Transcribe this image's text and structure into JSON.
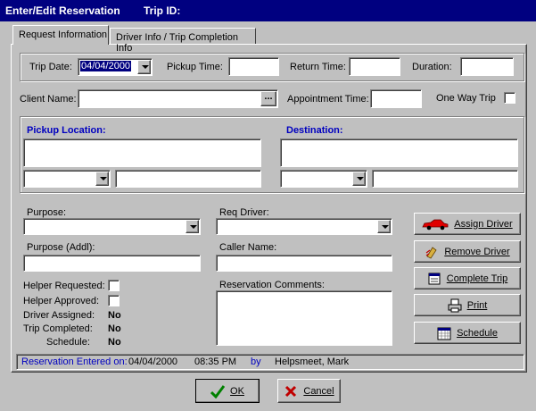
{
  "window": {
    "title": "Enter/Edit Reservation",
    "trip_id_label": "Trip ID:"
  },
  "tabs": [
    {
      "label": "Request Information"
    },
    {
      "label": "Driver Info / Trip Completion Info"
    }
  ],
  "trip": {
    "trip_date_label": "Trip Date:",
    "trip_date_value": "04/04/2000",
    "pickup_time_label": "Pickup Time:",
    "return_time_label": "Return Time:",
    "duration_label": "Duration:",
    "client_name_label": "Client Name:",
    "lookup_label": "...",
    "appointment_time_label": "Appointment Time:",
    "one_way_trip_label": "One Way Trip"
  },
  "locations": {
    "pickup_label": "Pickup Location:",
    "destination_label": "Destination:"
  },
  "form": {
    "purpose_label": "Purpose:",
    "purpose_addl_label": "Purpose (Addl):",
    "req_driver_label": "Req Driver:",
    "caller_name_label": "Caller Name:",
    "reservation_comments_label": "Reservation Comments:",
    "helper_requested_label": "Helper Requested:",
    "helper_approved_label": "Helper Approved:",
    "driver_assigned_label": "Driver Assigned:",
    "driver_assigned_value": "No",
    "trip_completed_label": "Trip Completed:",
    "trip_completed_value": "No",
    "schedule_label": "Schedule:",
    "schedule_value": "No"
  },
  "actions": {
    "assign_driver": "Assign Driver",
    "remove_driver": "Remove Driver",
    "complete_trip": "Complete Trip",
    "print": "Print",
    "schedule": "Schedule"
  },
  "status": {
    "entered_on_label": "Reservation Entered on:",
    "date": "04/04/2000",
    "time": "08:35 PM",
    "by_label": "by",
    "user": "Helpsmeet, Mark"
  },
  "footer": {
    "ok_label": "OK",
    "cancel_label": "Cancel"
  },
  "colors": {
    "title_bar": "#000080",
    "accent_blue": "#0000c0",
    "face": "#c0c0c0",
    "selection": "#000080"
  },
  "icons": {
    "assign_driver": "red-car-icon",
    "remove_driver": "eraser-icon",
    "complete_trip": "calendar-page-icon",
    "print": "printer-icon",
    "schedule": "calendar-grid-icon",
    "ok": "green-check-icon",
    "cancel": "red-x-icon"
  }
}
